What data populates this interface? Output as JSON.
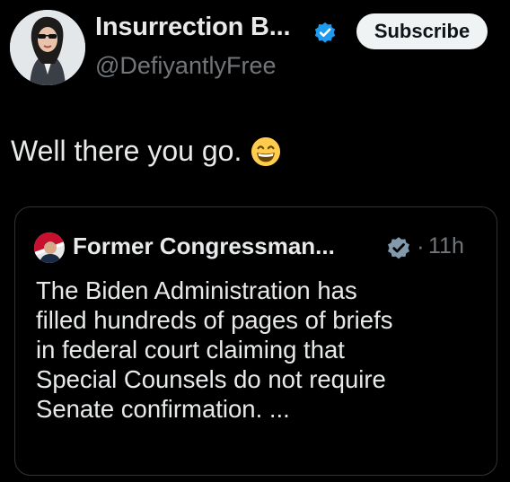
{
  "tweet": {
    "author": {
      "display_name": "Insurrection B...",
      "handle": "@DefiyantlyFree",
      "verified_color": "#1d9bf0"
    },
    "subscribe_label": "Subscribe",
    "text": "Well there you go.",
    "emoji": "grinning-face-emoji"
  },
  "quote": {
    "author": {
      "display_name": "Former Congressman...",
      "verified_color": "#829aab"
    },
    "separator": "·",
    "time": "11h",
    "lines": [
      "The Biden Administration has",
      "filled hundreds of pages of briefs",
      "in federal court claiming that",
      "Special Counsels do not require",
      "Senate confirmation. ..."
    ]
  }
}
